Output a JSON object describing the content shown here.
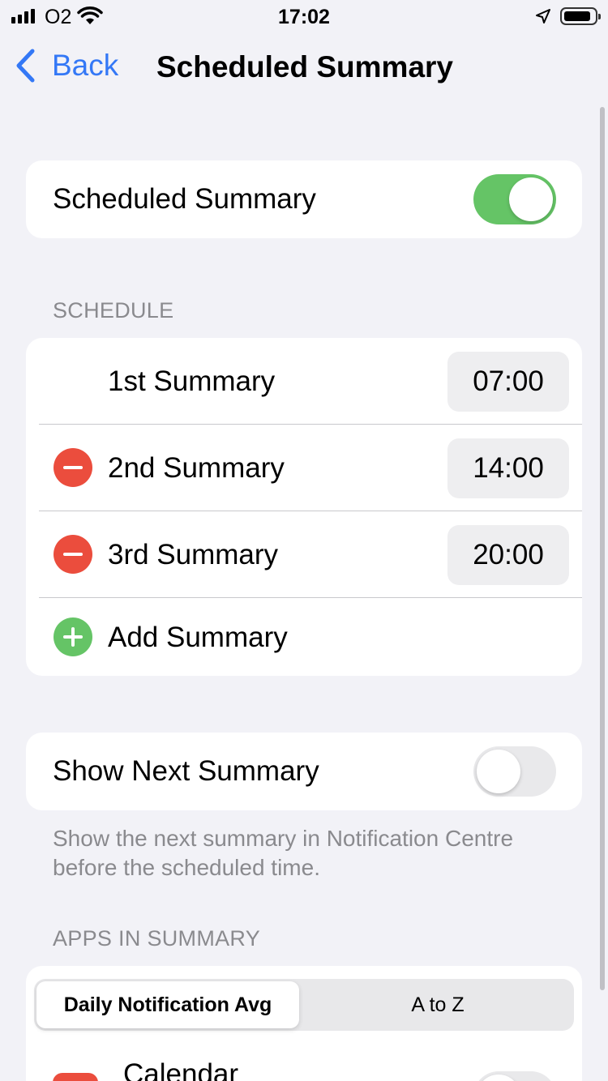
{
  "status_bar": {
    "carrier": "O2",
    "time": "17:02"
  },
  "nav": {
    "back_label": "Back",
    "title": "Scheduled Summary"
  },
  "scheduled_summary": {
    "label": "Scheduled Summary",
    "enabled": true
  },
  "schedule": {
    "header": "SCHEDULE",
    "items": [
      {
        "label": "1st Summary",
        "time": "07:00",
        "removable": false
      },
      {
        "label": "2nd Summary",
        "time": "14:00",
        "removable": true
      },
      {
        "label": "3rd Summary",
        "time": "20:00",
        "removable": true
      }
    ],
    "add_label": "Add Summary"
  },
  "show_next_summary": {
    "label": "Show Next Summary",
    "enabled": false,
    "footer": "Show the next summary in Notification Centre before the scheduled time."
  },
  "apps_in_summary": {
    "header": "APPS IN SUMMARY",
    "segments": [
      "Daily Notification Avg",
      "A to Z"
    ],
    "selected_segment": "Daily Notification Avg",
    "first_app": "Calendar"
  },
  "colors": {
    "accent": "#3478f6",
    "toggle_on": "#65c466",
    "remove": "#eb4d3d",
    "background": "#f2f2f7"
  }
}
